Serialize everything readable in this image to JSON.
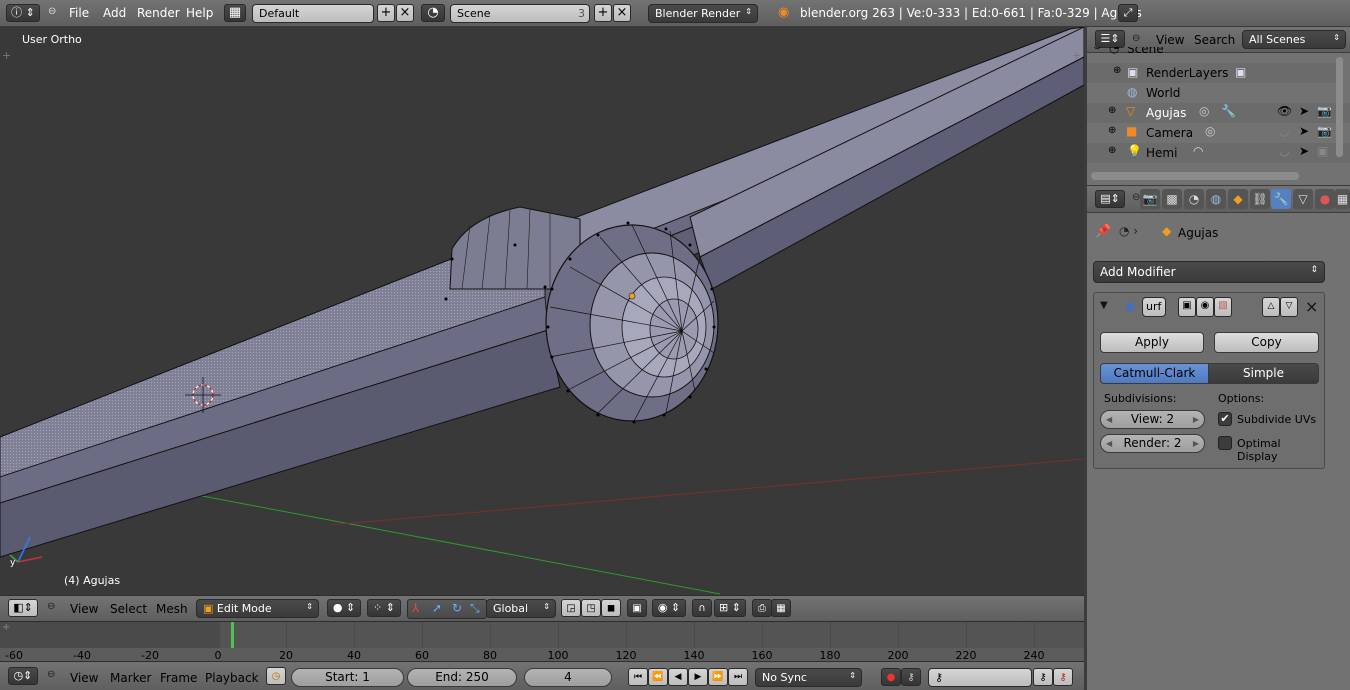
{
  "topbar": {
    "menus": [
      "File",
      "Add",
      "Render",
      "Help"
    ],
    "layout": "Default",
    "scene": "Scene",
    "scene_users": "3",
    "engine": "Blender Render",
    "stats": "blender.org 263 | Ve:0-333 | Ed:0-661 | Fa:0-329 | Agujas"
  },
  "viewport": {
    "view_label": "User Ortho",
    "object_label": "(4) Agujas"
  },
  "view_header": {
    "menus": [
      "View",
      "Select",
      "Mesh"
    ],
    "mode": "Edit Mode",
    "orientation": "Global"
  },
  "timeline": {
    "ticks": [
      "-60",
      "-40",
      "-20",
      "0",
      "20",
      "40",
      "60",
      "80",
      "100",
      "120",
      "140",
      "160",
      "180",
      "200",
      "220",
      "240"
    ],
    "current_frame_fraction": 0.255
  },
  "timeline_header": {
    "menus": [
      "View",
      "Marker",
      "Frame",
      "Playback"
    ],
    "start": "Start: 1",
    "end": "End: 250",
    "frame": "4",
    "sync": "No Sync"
  },
  "outliner": {
    "menus": [
      "View",
      "Search"
    ],
    "filter": "All Scenes",
    "items": [
      {
        "name": "Scene"
      },
      {
        "name": "RenderLayers"
      },
      {
        "name": "World"
      },
      {
        "name": "Agujas"
      },
      {
        "name": "Camera"
      },
      {
        "name": "Hemi"
      }
    ]
  },
  "properties": {
    "object_name": "Agujas",
    "add_modifier": "Add Modifier",
    "modifier_name": "urf",
    "apply": "Apply",
    "copy": "Copy",
    "method_a": "Catmull-Clark",
    "method_b": "Simple",
    "subdivisions_label": "Subdivisions:",
    "options_label": "Options:",
    "view_levels": "View: 2",
    "render_levels": "Render: 2",
    "subdivide_uvs": "Subdivide UVs",
    "optimal_display": "Optimal Display"
  },
  "colors": {
    "accent": "#5680c2",
    "viewport_bg": "#393939",
    "mesh_face": "#7b7b91"
  }
}
